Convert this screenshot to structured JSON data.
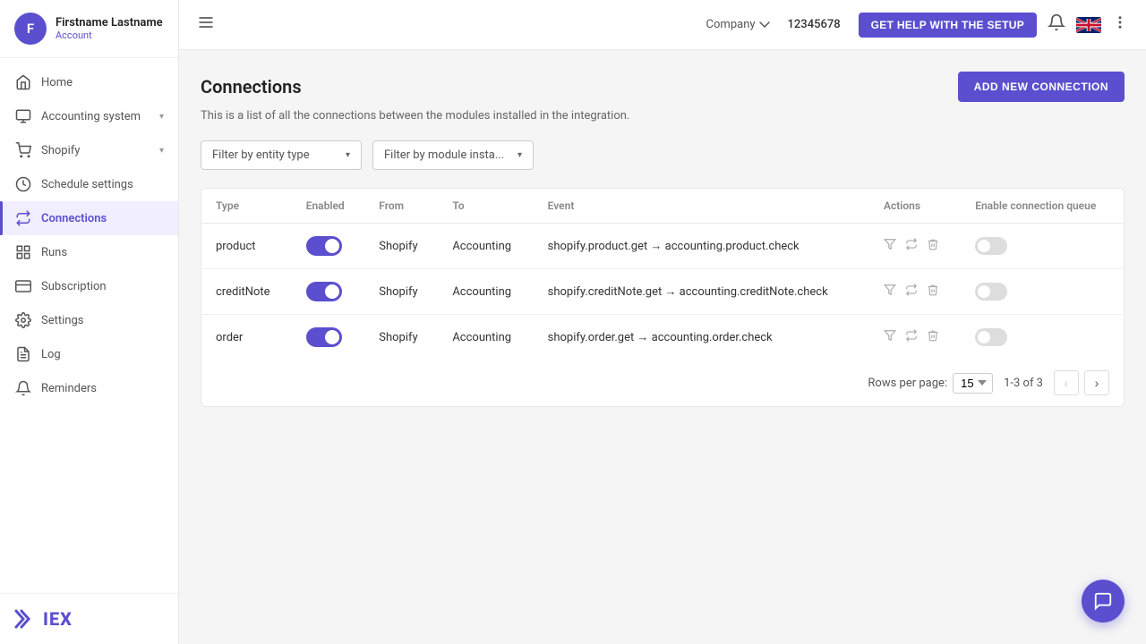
{
  "sidebar": {
    "user": {
      "initials": "F",
      "name": "Firstname Lastname",
      "role": "Account"
    },
    "nav": [
      {
        "id": "home",
        "label": "Home",
        "icon": "home",
        "active": false,
        "hasChevron": false
      },
      {
        "id": "accounting",
        "label": "Accounting system",
        "icon": "accounting",
        "active": false,
        "hasChevron": true
      },
      {
        "id": "shopify",
        "label": "Shopify",
        "icon": "shopify",
        "active": false,
        "hasChevron": true
      },
      {
        "id": "schedule",
        "label": "Schedule settings",
        "icon": "schedule",
        "active": false,
        "hasChevron": false
      },
      {
        "id": "connections",
        "label": "Connections",
        "icon": "connections",
        "active": true,
        "hasChevron": false
      },
      {
        "id": "runs",
        "label": "Runs",
        "icon": "runs",
        "active": false,
        "hasChevron": false
      },
      {
        "id": "subscription",
        "label": "Subscription",
        "icon": "subscription",
        "active": false,
        "hasChevron": false
      },
      {
        "id": "settings",
        "label": "Settings",
        "icon": "settings",
        "active": false,
        "hasChevron": false
      },
      {
        "id": "log",
        "label": "Log",
        "icon": "log",
        "active": false,
        "hasChevron": false
      },
      {
        "id": "reminders",
        "label": "Reminders",
        "icon": "reminders",
        "active": false,
        "hasChevron": false
      }
    ],
    "logo": "✕ IEX"
  },
  "topbar": {
    "company_label": "Company",
    "company_id": "12345678",
    "help_button": "GET HELP WITH THE SETUP",
    "more_icon": "⋯"
  },
  "page": {
    "title": "Connections",
    "subtitle": "This is a list of all the connections between the modules installed in the integration.",
    "add_button": "ADD NEW CONNECTION",
    "filters": {
      "entity_placeholder": "Filter by entity type",
      "module_placeholder": "Filter by module insta..."
    },
    "table": {
      "columns": [
        "Type",
        "Enabled",
        "From",
        "To",
        "Event",
        "Actions",
        "Enable connection queue"
      ],
      "rows": [
        {
          "type": "product",
          "enabled": true,
          "from": "Shopify",
          "to": "Accounting",
          "event": "shopify.product.get → accounting.product.check",
          "queue_enabled": false
        },
        {
          "type": "creditNote",
          "enabled": true,
          "from": "Shopify",
          "to": "Accounting",
          "event": "shopify.creditNote.get → accounting.creditNote.check",
          "queue_enabled": false
        },
        {
          "type": "order",
          "enabled": true,
          "from": "Shopify",
          "to": "Accounting",
          "event": "shopify.order.get → accounting.order.check",
          "queue_enabled": false
        }
      ]
    },
    "pagination": {
      "rows_per_page_label": "Rows per page:",
      "rows_per_page_value": "15",
      "page_info": "1-3 of 3"
    }
  }
}
